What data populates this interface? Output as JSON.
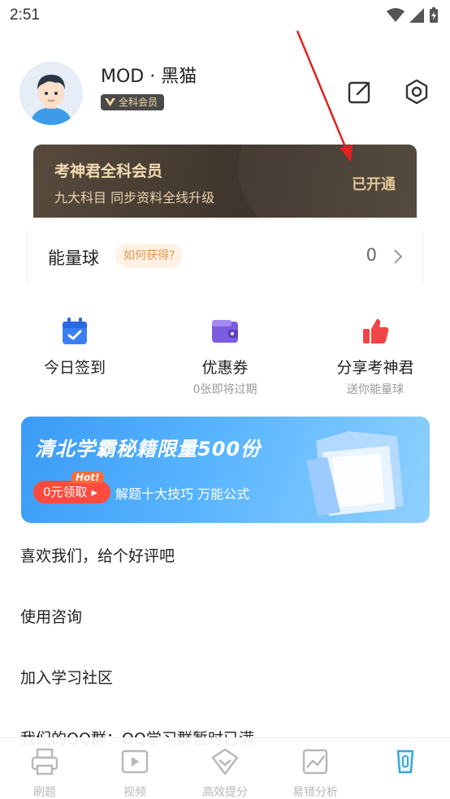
{
  "status_bar": {
    "time": "2:51"
  },
  "profile": {
    "username": "MOD · 黑猫",
    "member_tag": "全科会员"
  },
  "vip_card": {
    "title": "考神君全科会员",
    "subtitle": "九大科目 同步资料全线升级",
    "status": "已开通"
  },
  "energy": {
    "label": "能量球",
    "how_to_get": "如何获得?",
    "count": "0"
  },
  "quick_actions": [
    {
      "label": "今日签到",
      "sub": "",
      "icon": "calendar-check-icon",
      "color": "#3b7ff5"
    },
    {
      "label": "优惠券",
      "sub": "0张即将过期",
      "icon": "wallet-icon",
      "color": "#7c5ce0"
    },
    {
      "label": "分享考神君",
      "sub": "送你能量球",
      "icon": "thumbs-up-icon",
      "color": "#f04545"
    }
  ],
  "banner": {
    "title": "清北学霸秘籍限量500份",
    "hot": "Hot!",
    "button": "0元领取",
    "subtitle": "解题十大技巧 万能公式"
  },
  "menu": [
    {
      "label": "喜欢我们，给个好评吧"
    },
    {
      "label": "使用咨询"
    },
    {
      "label": "加入学习社区"
    },
    {
      "label": "我们的QQ群：QQ学习群暂时已满"
    }
  ],
  "tabs": [
    {
      "label": "刷题",
      "icon": "printer-icon"
    },
    {
      "label": "视频",
      "icon": "video-icon"
    },
    {
      "label": "高效提分",
      "icon": "heart-check-icon"
    },
    {
      "label": "易错分析",
      "icon": "chart-icon"
    },
    {
      "label": "",
      "icon": "profile-icon",
      "active": true
    }
  ],
  "colors": {
    "vip_gold": "#e3c595",
    "accent_blue": "#3a9bf6",
    "tab_active": "#3aa7d8",
    "tab_inactive": "#b8b8b8"
  }
}
